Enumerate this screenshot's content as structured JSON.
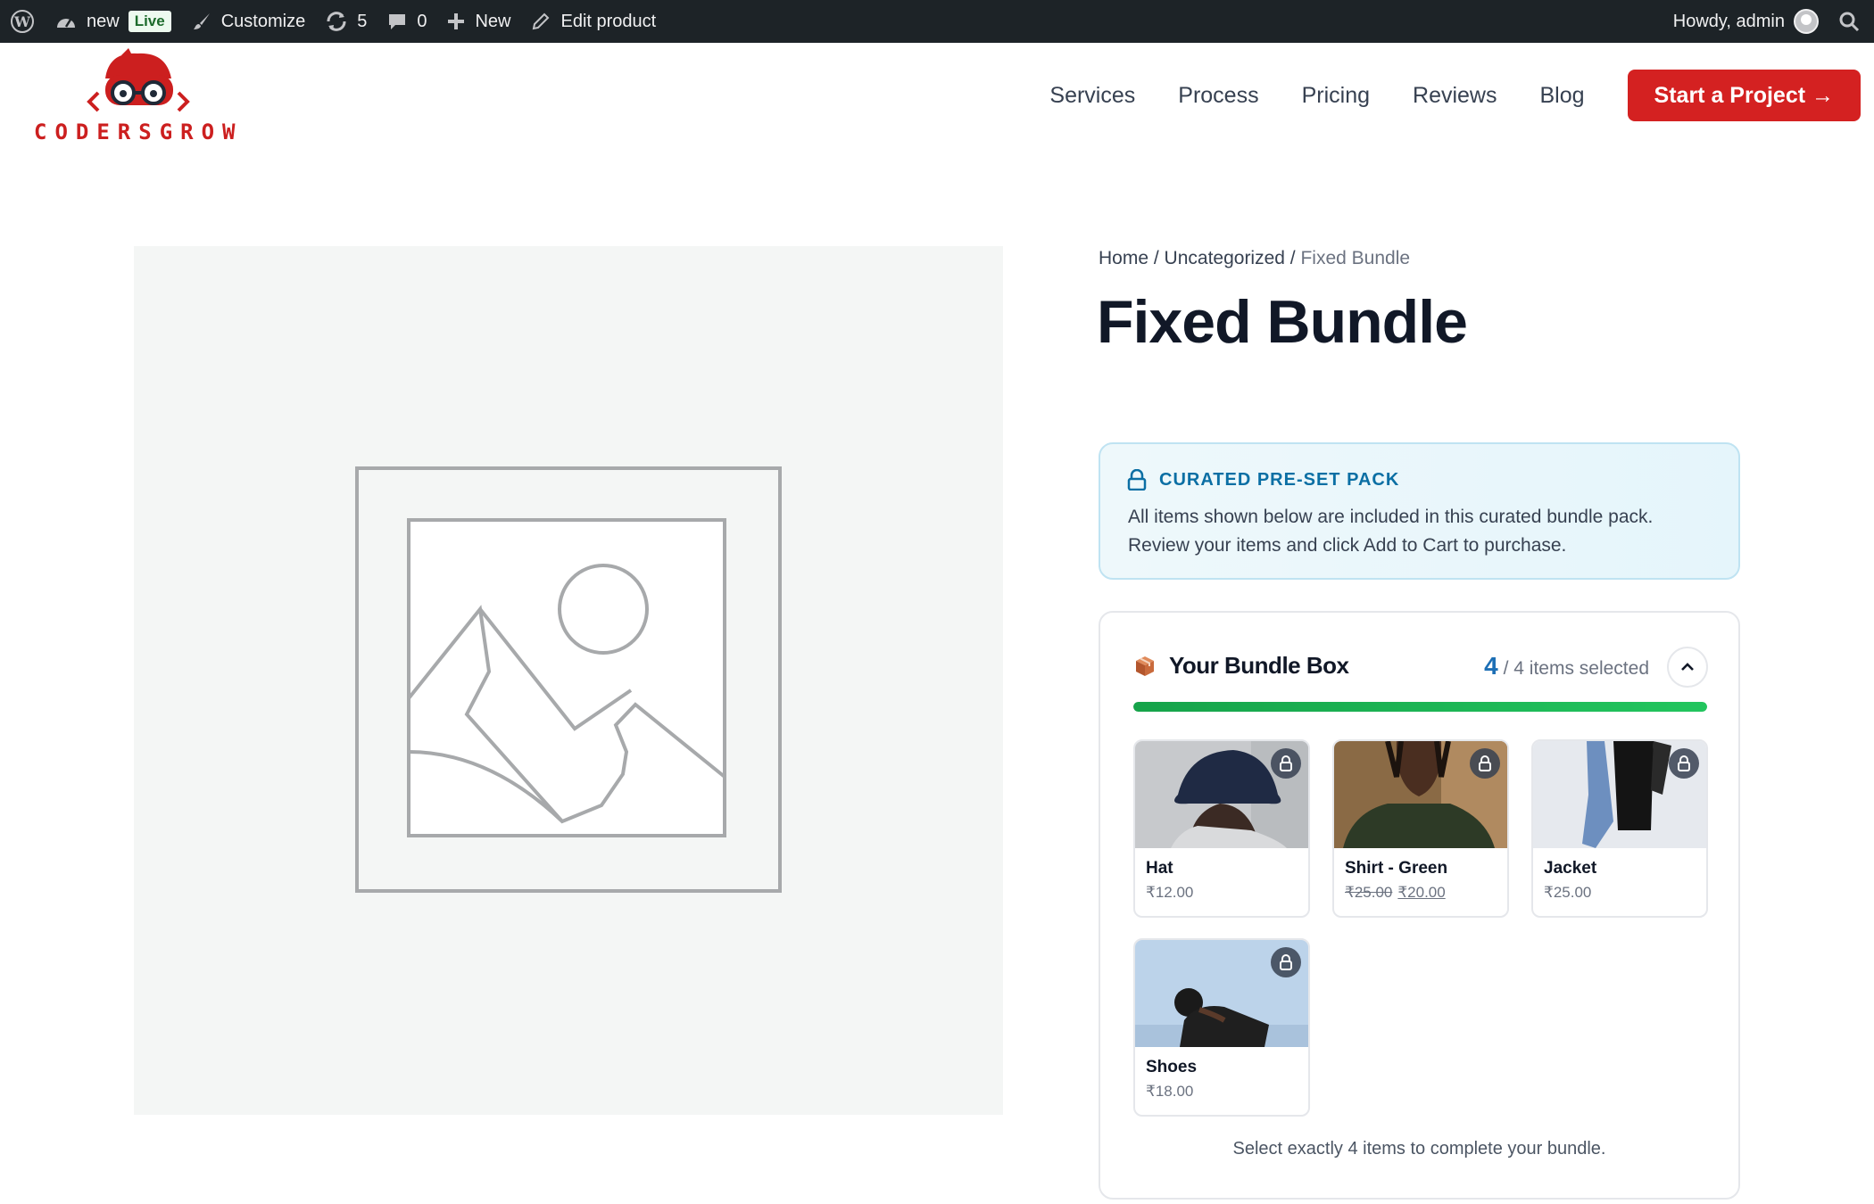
{
  "admin_bar": {
    "site_name": "new",
    "live_badge": "Live",
    "customize": "Customize",
    "updates_count": "5",
    "comments_count": "0",
    "new_label": "New",
    "edit_label": "Edit product",
    "howdy": "Howdy, admin"
  },
  "header": {
    "logo_text": "CODERSGROW",
    "nav": [
      "Services",
      "Process",
      "Pricing",
      "Reviews",
      "Blog"
    ],
    "cta": "Start a Project →"
  },
  "breadcrumb": {
    "home": "Home",
    "category": "Uncategorized",
    "current": "Fixed Bundle",
    "sep": " / "
  },
  "product": {
    "title": "Fixed Bundle"
  },
  "notice": {
    "heading": "CURATED PRE-SET PACK",
    "line1": "All items shown below are included in this curated bundle pack.",
    "line2": "Review your items and click Add to Cart to purchase."
  },
  "bundle": {
    "title": "Your Bundle Box",
    "selected": "4",
    "total_text": "/ 4 items selected",
    "progress_fraction": 1.0,
    "items": [
      {
        "name": "Hat",
        "price": "₹12.00",
        "old_price": ""
      },
      {
        "name": "Shirt - Green",
        "price": "₹20.00",
        "old_price": "₹25.00"
      },
      {
        "name": "Jacket",
        "price": "₹25.00",
        "old_price": ""
      },
      {
        "name": "Shoes",
        "price": "₹18.00",
        "old_price": ""
      }
    ],
    "footer": "Select exactly 4 items to complete your bundle."
  }
}
